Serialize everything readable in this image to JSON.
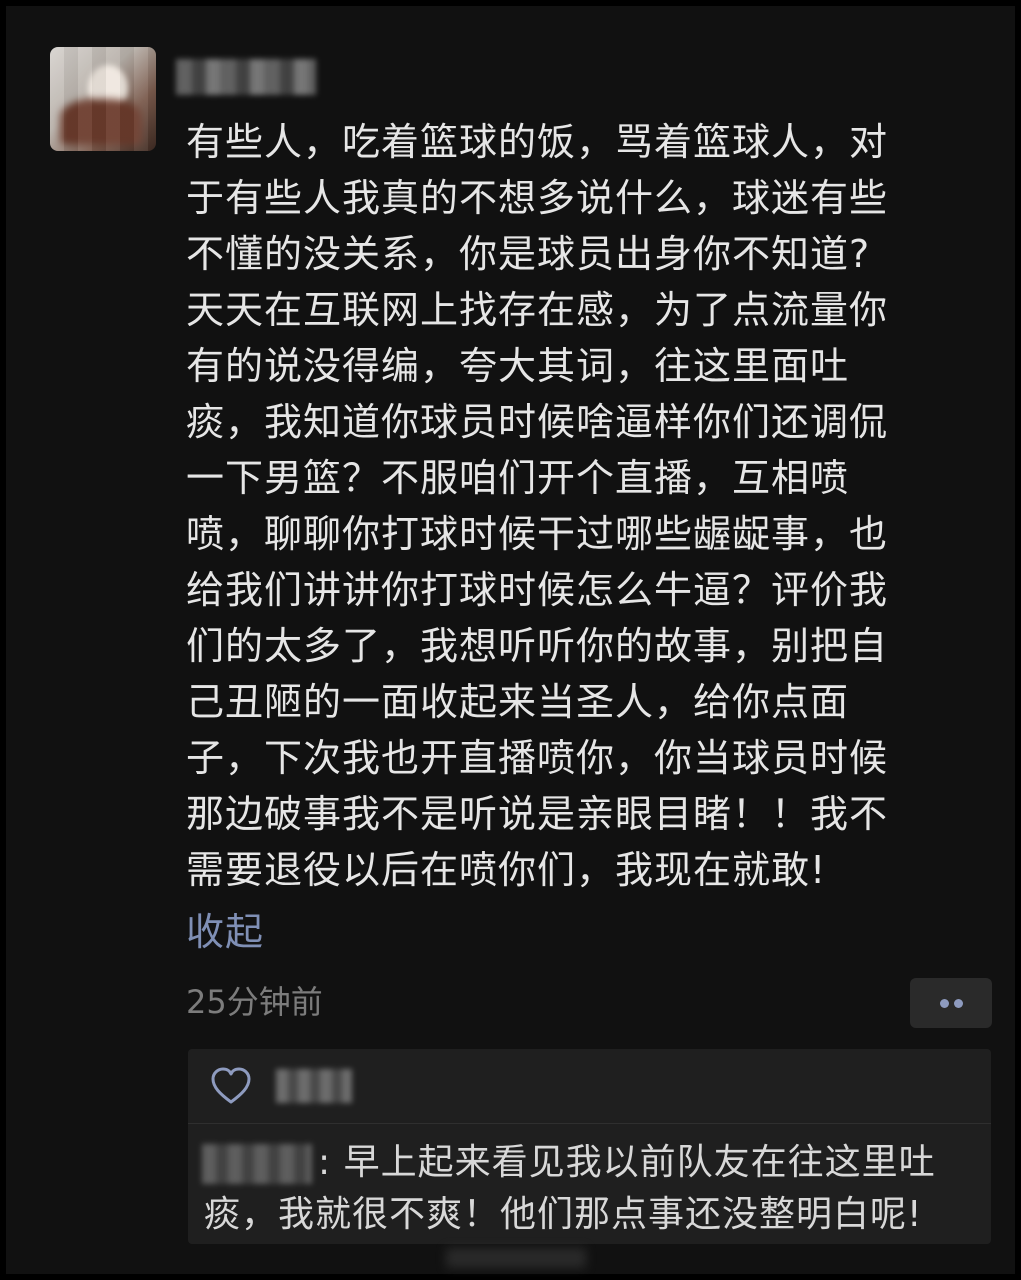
{
  "post": {
    "lines": [
      "有些人，吃着篮球的饭，骂着篮球人，对",
      "于有些人我真的不想多说什么，球迷有些",
      "不懂的没关系，你是球员出身你不知道?",
      "天天在互联网上找存在感，为了点流量你",
      "有的说没得编，夸大其词，往这里面吐",
      "痰，我知道你球员时候啥逼样你们还调侃",
      "一下男篮？不服咱们开个直播，互相喷",
      "喷，聊聊你打球时候干过哪些龌龊事，也",
      "给我们讲讲你打球时候怎么牛逼？评价我",
      "们的太多了，我想听听你的故事，别把自",
      "己丑陋的一面收起来当圣人，给你点面",
      "子，下次我也开直播喷你，你当球员时候",
      "那边破事我不是听说是亲眼目睹！！我不",
      "需要退役以后在喷你们，我现在就敢!"
    ],
    "collapse_label": "收起",
    "timestamp": "25分钟前"
  },
  "comment": {
    "lines": [
      ": 早上起来看见我以前队友在往这里吐",
      "痰，我就很不爽！他们那点事还没整明白呢!"
    ]
  },
  "icons": {
    "like": "heart-icon",
    "more": "more-dots-icon"
  },
  "colors": {
    "background": "#111111",
    "text": "#e6e6e6",
    "link": "#7f8fb5",
    "muted": "#7c7c7c",
    "comment_bg": "#1f1f1f"
  }
}
